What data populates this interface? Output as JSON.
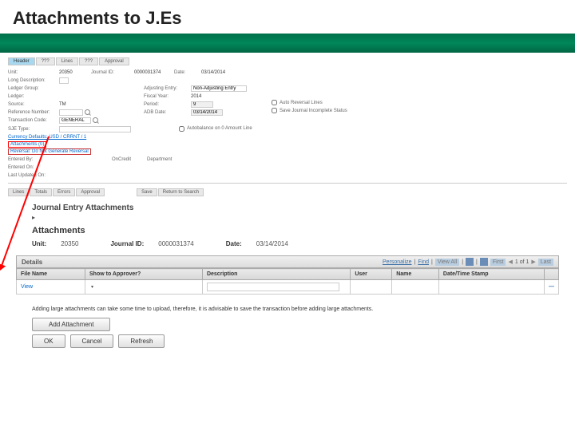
{
  "page_title": "Attachments to J.Es",
  "top_tabs": [
    "Header",
    "???",
    "Lines",
    "???",
    "Approval"
  ],
  "form": {
    "row1": {
      "unit_label": "Unit:",
      "unit_val": "20350",
      "jid_label": "Journal ID:",
      "jid_val": "0000031374",
      "date_label": "Date:",
      "date_val": "03/14/2014"
    },
    "long_desc_label": "Long Description:",
    "ledger_group_label": "Ledger Group:",
    "adjusting_label": "Adjusting Entry:",
    "adjusting_val": "Non-Adjusting Entry",
    "ledger_label": "Ledger:",
    "fiscal_label": "Fiscal Year:",
    "fiscal_val": "2014",
    "source_label": "Source:",
    "source_val": "TM",
    "period_label": "Period:",
    "period_val": "9",
    "ref_label": "Reference Number:",
    "adb_label": "ADB Date:",
    "adb_val": "03/14/2014",
    "trx_label": "Transaction Code:",
    "trx_val": "GENERAL",
    "auto_reversal": "Auto Reversal Lines",
    "save_incomplete": "Save Journal Incomplete Status",
    "sjetype_label": "SJE Type:",
    "autobalance": "Autobalance on 0 Amount Line",
    "currency_default": "Currency Defaults: USD / CRRNT / 1",
    "attachments_link": "Attachments (0)",
    "reversal_label": "Reversal: Do Not Generate Reversal",
    "entered_label": "Entered By:",
    "entered2_label": "Entered On:",
    "oncredit_label": "OnCredit",
    "dept_label": "Department",
    "updated_label": "Last Updated On:"
  },
  "sub_tabs": [
    "Lines",
    "Totals",
    "Errors",
    "Approval"
  ],
  "sub_tabs2": [
    "Save",
    "Return to Search"
  ],
  "section_journal": "Journal Entry Attachments",
  "section_attachments": "Attachments",
  "id_row": {
    "unit_k": "Unit:",
    "unit_v": "20350",
    "jid_k": "Journal ID:",
    "jid_v": "0000031374",
    "date_k": "Date:",
    "date_v": "03/14/2014"
  },
  "details_bar": {
    "title": "Details",
    "personalize": "Personalize",
    "find": "Find",
    "viewall": "View All",
    "first": "First",
    "nav": "1 of 1",
    "last": "Last"
  },
  "table": {
    "headers": [
      "File Name",
      "Show to Approver?",
      "Description",
      "User",
      "Name",
      "Date/Time Stamp",
      ""
    ],
    "row": {
      "view": "View",
      "dash": "—"
    }
  },
  "note_text": "Adding large attachments can take some time to upload, therefore, it is advisable to save the transaction before adding large attachments.",
  "buttons": {
    "add": "Add Attachment",
    "ok": "OK",
    "cancel": "Cancel",
    "refresh": "Refresh"
  }
}
